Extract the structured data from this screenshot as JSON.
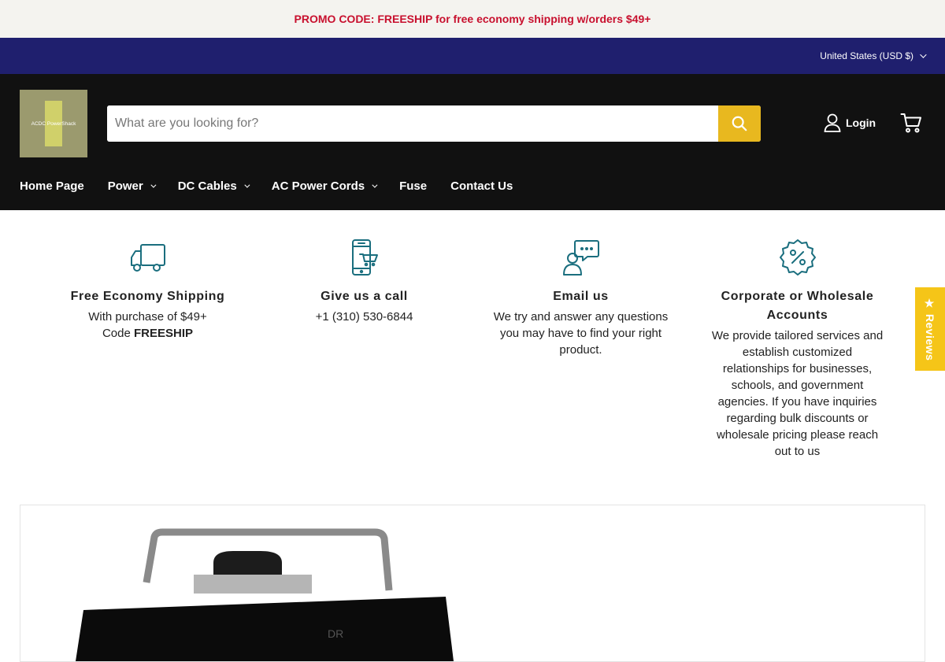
{
  "promo": {
    "text": "PROMO CODE: FREESHIP for free economy shipping w/orders $49+"
  },
  "currency": {
    "label": "United States (USD $)"
  },
  "header": {
    "logo_text": "ACDC PowerShack",
    "search_placeholder": "What are you looking for?",
    "login_label": "Login"
  },
  "nav": {
    "items": [
      {
        "label": "Home Page",
        "dropdown": false
      },
      {
        "label": "Power",
        "dropdown": true
      },
      {
        "label": "DC Cables",
        "dropdown": true
      },
      {
        "label": "AC Power Cords",
        "dropdown": true
      },
      {
        "label": "Fuse",
        "dropdown": false
      },
      {
        "label": "Contact Us",
        "dropdown": false
      }
    ]
  },
  "features": [
    {
      "icon": "truck-icon",
      "title": "Free Economy Shipping",
      "line1": "With purchase of $49+",
      "line2_prefix": "Code ",
      "line2_bold": "FREESHIP"
    },
    {
      "icon": "phone-cart-icon",
      "title": "Give us a call",
      "text": "+1 (310) 530-6844"
    },
    {
      "icon": "chat-person-icon",
      "title": "Email us",
      "text": "We try and answer any questions you may have to find your right product."
    },
    {
      "icon": "discount-badge-icon",
      "title": "Corporate or Wholesale Accounts",
      "text": "We provide tailored services and establish customized relationships for businesses, schools, and government agencies. If you have inquiries regarding bulk discounts or wholesale pricing please reach out to us"
    }
  ],
  "reviews_tab": {
    "label": "★ Reviews"
  },
  "colors": {
    "promo_text": "#c8102e",
    "currency_bar": "#1f1f6e",
    "header_bg": "#111111",
    "search_button": "#e8b81f",
    "icon_teal": "#1a6e7e",
    "reviews_tab": "#f5c518"
  }
}
